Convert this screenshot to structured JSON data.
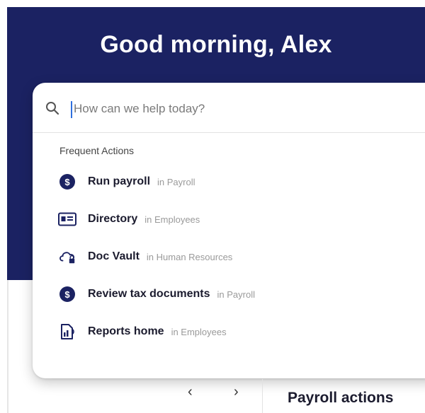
{
  "hero": {
    "greeting": "Good morning, Alex"
  },
  "search": {
    "placeholder": "How can we help today?",
    "value": ""
  },
  "frequent_actions": {
    "title": "Frequent Actions",
    "items": [
      {
        "name": "Run payroll",
        "location": "in Payroll",
        "icon": "dollar-coin-icon"
      },
      {
        "name": "Directory",
        "location": "in Employees",
        "icon": "id-card-icon"
      },
      {
        "name": "Doc Vault",
        "location": "in Human Resources",
        "icon": "cloud-lock-icon"
      },
      {
        "name": "Review tax documents",
        "location": "in Payroll",
        "icon": "dollar-coin-icon"
      },
      {
        "name": "Reports home",
        "location": "in Employees",
        "icon": "report-document-icon"
      }
    ]
  },
  "pagination": {
    "prev": "‹",
    "next": "›"
  },
  "panel": {
    "title": "Payroll actions"
  },
  "colors": {
    "brand_navy": "#1b2262",
    "cursor_blue": "#2f6fde"
  }
}
